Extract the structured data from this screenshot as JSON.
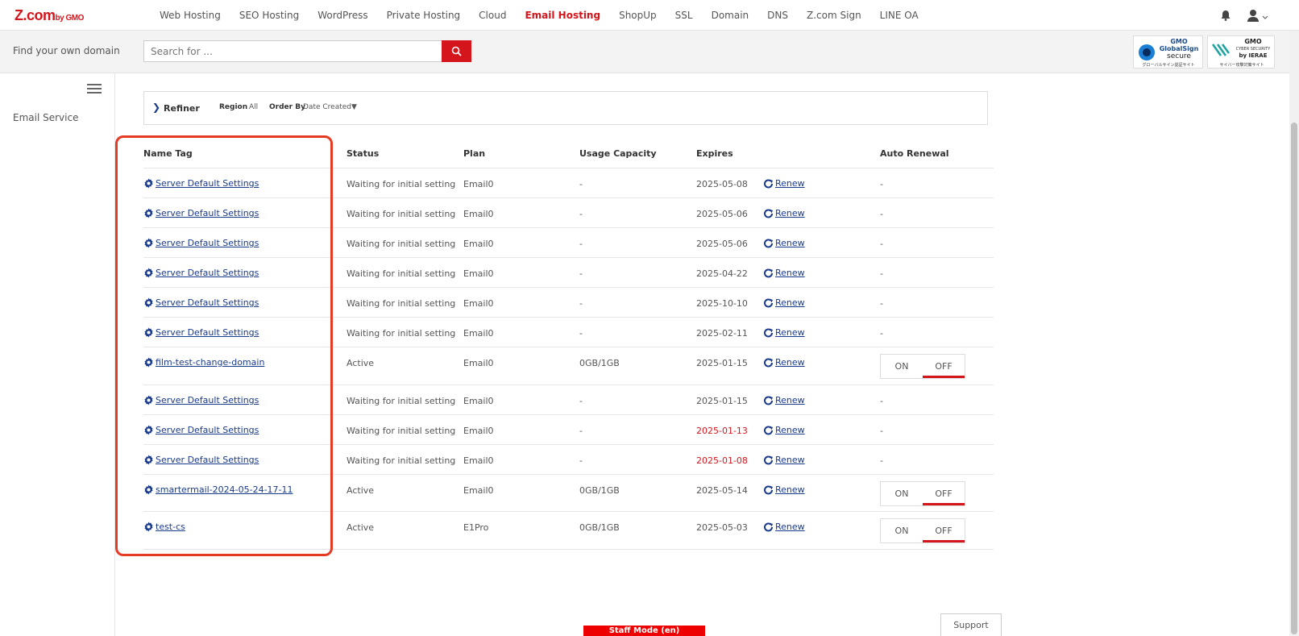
{
  "brand": {
    "logo": "Z.com",
    "logo_sub": "by GMO"
  },
  "nav": [
    "Web Hosting",
    "SEO Hosting",
    "WordPress",
    "Private Hosting",
    "Cloud",
    "Email Hosting",
    "ShopUp",
    "SSL",
    "Domain",
    "DNS",
    "Z.com Sign",
    "LINE OA"
  ],
  "nav_active": "Email Hosting",
  "search": {
    "label": "Find your own domain",
    "placeholder": "Search for ..."
  },
  "badges": {
    "globalsign": {
      "l1": "GMO",
      "l2": "GlobalSign",
      "l3": "secure",
      "l4": "グローバルサイン認証サイト"
    },
    "ierae": {
      "l1": "GMO",
      "l2": "CYBER SECURITY",
      "l3": "by IERAE",
      "l4": "サイバー攻撃対策サイト"
    }
  },
  "sidebar": {
    "items": [
      "Email Service"
    ]
  },
  "refiner": {
    "title": "Refiner",
    "region_label": "Region",
    "region_value": "All",
    "order_label": "Order By",
    "order_value": "Date Created▼"
  },
  "table": {
    "headers": {
      "name": "Name Tag",
      "status": "Status",
      "plan": "Plan",
      "usage": "Usage Capacity",
      "expires": "Expires",
      "auto": "Auto Renewal"
    },
    "renew_label": "Renew",
    "toggle_on": "ON",
    "toggle_off": "OFF",
    "rows": [
      {
        "name": "Server Default Settings",
        "status": "Waiting for initial setting",
        "plan": "Email0",
        "usage": "-",
        "expires": "2025-05-08",
        "expired": false,
        "auto": "-"
      },
      {
        "name": "Server Default Settings",
        "status": "Waiting for initial setting",
        "plan": "Email0",
        "usage": "-",
        "expires": "2025-05-06",
        "expired": false,
        "auto": "-"
      },
      {
        "name": "Server Default Settings",
        "status": "Waiting for initial setting",
        "plan": "Email0",
        "usage": "-",
        "expires": "2025-05-06",
        "expired": false,
        "auto": "-"
      },
      {
        "name": "Server Default Settings",
        "status": "Waiting for initial setting",
        "plan": "Email0",
        "usage": "-",
        "expires": "2025-04-22",
        "expired": false,
        "auto": "-"
      },
      {
        "name": "Server Default Settings",
        "status": "Waiting for initial setting",
        "plan": "Email0",
        "usage": "-",
        "expires": "2025-10-10",
        "expired": false,
        "auto": "-"
      },
      {
        "name": "Server Default Settings",
        "status": "Waiting for initial setting",
        "plan": "Email0",
        "usage": "-",
        "expires": "2025-02-11",
        "expired": false,
        "auto": "-"
      },
      {
        "name": "film-test-change-domain",
        "status": "Active",
        "plan": "Email0",
        "usage": "0GB/1GB",
        "expires": "2025-01-15",
        "expired": false,
        "auto": "toggle"
      },
      {
        "name": "Server Default Settings",
        "status": "Waiting for initial setting",
        "plan": "Email0",
        "usage": "-",
        "expires": "2025-01-15",
        "expired": false,
        "auto": "-"
      },
      {
        "name": "Server Default Settings",
        "status": "Waiting for initial setting",
        "plan": "Email0",
        "usage": "-",
        "expires": "2025-01-13",
        "expired": true,
        "auto": "-"
      },
      {
        "name": "Server Default Settings",
        "status": "Waiting for initial setting",
        "plan": "Email0",
        "usage": "-",
        "expires": "2025-01-08",
        "expired": true,
        "auto": "-"
      },
      {
        "name": "smartermail-2024-05-24-17-11",
        "status": "Active",
        "plan": "Email0",
        "usage": "0GB/1GB",
        "expires": "2025-05-14",
        "expired": false,
        "auto": "toggle"
      },
      {
        "name": "test-cs",
        "status": "Active",
        "plan": "E1Pro",
        "usage": "0GB/1GB",
        "expires": "2025-05-03",
        "expired": false,
        "auto": "toggle"
      }
    ]
  },
  "footer": {
    "staff_mode": "Staff Mode (en)",
    "support": "Support"
  },
  "colors": {
    "accent": "#d4161c",
    "link": "#1a3a8c",
    "highlight": "#e53a24"
  }
}
